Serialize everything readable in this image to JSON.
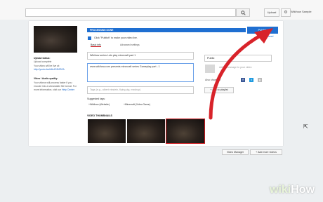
{
  "topbar": {
    "upload_label": "Upload",
    "user_name": "Wikihow Sample"
  },
  "sidebar": {
    "upload_status_label": "Upload status:",
    "upload_status_value": "Upload complete",
    "video_url_label": "Your video will be live at:",
    "video_url": "http://youtu.be/d4b4G3tZ3ZA",
    "quality_label": "Video / Audio quality:",
    "quality_desc": "Your videos will process faster if you encode into a streamable file format. For more information, visit our",
    "help_link": "Help Center"
  },
  "status": {
    "message": "PROCESSING DONE",
    "publish_label": "Publish",
    "draft_label": "Draft saved",
    "click_message": "Click \"Publish\" to make your video live."
  },
  "tabs": [
    {
      "label": "Basic info",
      "active": true
    },
    {
      "label": "Advanced settings",
      "active": false
    }
  ],
  "form": {
    "title_value": "Wikihow series Lets play minecraft part   1",
    "description_value": "www.wikihow.com presents minecraft series Gameplay part - 1",
    "tags_placeholder": "Tags (e.g., albert einstein, flying pig, mashup)",
    "suggested_label": "Suggested tags:",
    "suggested_tags": [
      "+Wikihow (Website)",
      "+Minecraft (Video Game)"
    ],
    "thumbnails_label": "VIDEO THUMBNAILS"
  },
  "right_panel": {
    "privacy_value": "Public",
    "add_message_placeholder": "Add a message to your video",
    "share_label": "Also share on",
    "add_playlist_label": "+ Add to playlist"
  },
  "footer": {
    "video_manager_label": "Video Manager",
    "add_more_label": "+ Add more videos"
  },
  "watermark": {
    "wiki": "wiki",
    "how": "How"
  },
  "colors": {
    "accent_blue": "#1f6fd1",
    "annotation_red": "#d8232a"
  }
}
